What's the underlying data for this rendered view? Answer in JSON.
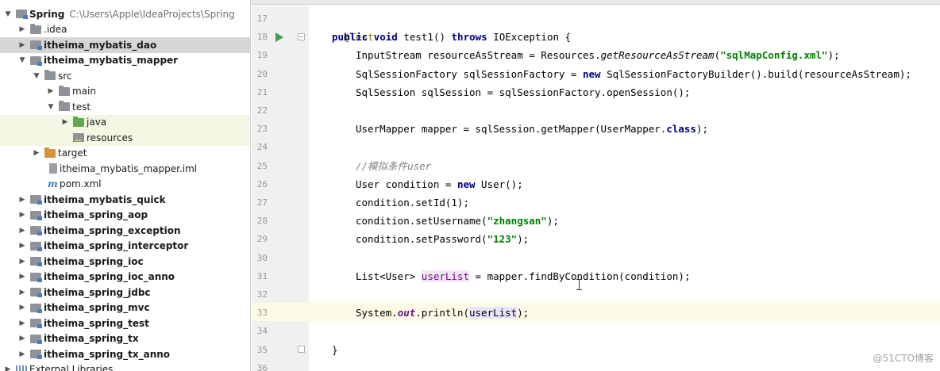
{
  "project_tree": {
    "root": {
      "label": "Spring",
      "path": "C:\\Users\\Apple\\IdeaProjects\\Spring"
    },
    "items": [
      {
        "label": ".idea"
      },
      {
        "label": "itheima_mybatis_dao"
      },
      {
        "label": "itheima_mybatis_mapper"
      },
      {
        "label": "src"
      },
      {
        "label": "main"
      },
      {
        "label": "test"
      },
      {
        "label": "java"
      },
      {
        "label": "resources"
      },
      {
        "label": "target"
      },
      {
        "label": "itheima_mybatis_mapper.iml"
      },
      {
        "label": "pom.xml"
      },
      {
        "label": "itheima_mybatis_quick"
      },
      {
        "label": "itheima_spring_aop"
      },
      {
        "label": "itheima_spring_exception"
      },
      {
        "label": "itheima_spring_interceptor"
      },
      {
        "label": "itheima_spring_ioc"
      },
      {
        "label": "itheima_spring_ioc_anno"
      },
      {
        "label": "itheima_spring_jdbc"
      },
      {
        "label": "itheima_spring_mvc"
      },
      {
        "label": "itheima_spring_test"
      },
      {
        "label": "itheima_spring_tx"
      },
      {
        "label": "itheima_spring_tx_anno"
      },
      {
        "label": "External Libraries"
      }
    ]
  },
  "editor": {
    "line_numbers": [
      "17",
      "18",
      "19",
      "20",
      "21",
      "22",
      "23",
      "24",
      "25",
      "26",
      "27",
      "28",
      "29",
      "30",
      "31",
      "32",
      "33",
      "34",
      "35",
      "36"
    ],
    "code": {
      "l17": "@Test",
      "l18": {
        "kw1": "public void",
        "rest": " test1() ",
        "kw2": "throws",
        "tail": " IOException {"
      },
      "l19": {
        "a": "InputStream resourceAsStream = Resources.",
        "m": "getResourceAsStream",
        "b": "(",
        "s": "\"sqlMapConfig.xml\"",
        "c": ");"
      },
      "l20": {
        "a": "SqlSessionFactory sqlSessionFactory = ",
        "kw": "new",
        "b": " SqlSessionFactoryBuilder().build(resourceAsStream);"
      },
      "l21": "SqlSession sqlSession = sqlSessionFactory.openSession();",
      "l23": {
        "a": "UserMapper mapper = sqlSession.getMapper(UserMapper.",
        "kw": "class",
        "b": ");"
      },
      "l25": {
        "a": "//模拟条件",
        "b": "user"
      },
      "l26": {
        "a": "User condition = ",
        "kw": "new",
        "b": " User();"
      },
      "l27": "condition.setId(1);",
      "l28": {
        "a": "condition.setUsername(",
        "s": "\"zhangsan\"",
        "b": ");"
      },
      "l29": {
        "a": "condition.setPassword(",
        "s": "\"123\"",
        "b": ");"
      },
      "l31": {
        "a": "List<User> ",
        "v": "userList",
        "b": " = mapper.findByCondition(condition);"
      },
      "l33": {
        "a": "System.",
        "f": "out",
        "b": ".println(",
        "v": "userList",
        "c": ");"
      },
      "l35": "}"
    }
  },
  "watermark": "@51CTO博客"
}
